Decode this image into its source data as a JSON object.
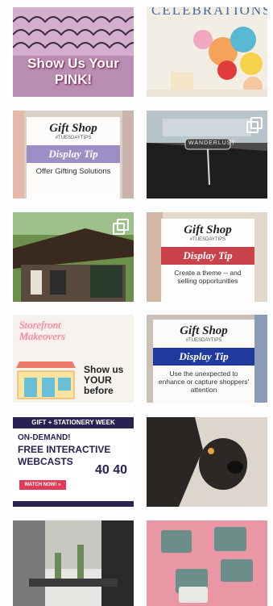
{
  "tiles": [
    {
      "id": "pink",
      "text": "Show Us Your PINK!"
    },
    {
      "id": "celebrations",
      "text": "CELEBRATIONS"
    },
    {
      "id": "tip1",
      "heading": "Gift Shop",
      "tag": "#TUESDAYTIPS",
      "band": "Display Tip",
      "sub": "Offer Gifting Solutions",
      "band_color": "#9b8fc6"
    },
    {
      "id": "wanderlust",
      "text": "WANDERLUST"
    },
    {
      "id": "storefront",
      "text": ""
    },
    {
      "id": "tip2",
      "heading": "Gift Shop",
      "tag": "#TUESDAYTIPS",
      "band": "Display Tip",
      "sub": "Create a theme -- and selling opportunities",
      "band_color": "#c9424a"
    },
    {
      "id": "makeovers",
      "neon": "Storefront Makeovers",
      "text": "Show us YOUR before"
    },
    {
      "id": "tip3",
      "heading": "Gift Shop",
      "tag": "#TUESDAYTIPS",
      "band": "Display Tip",
      "sub": "Use the unexpected to enhance or capture shoppers' attention",
      "band_color": "#1f3a9c"
    },
    {
      "id": "webcast",
      "header": "GIFT + STATIONERY WEEK",
      "line1": "ON-DEMAND!",
      "line2": "FREE INTERACTIVE",
      "line3": "WEBCASTS",
      "btn": "WATCH NOW! »",
      "logo": "40 40"
    },
    {
      "id": "dog",
      "text": ""
    },
    {
      "id": "display",
      "text": ""
    },
    {
      "id": "pouches",
      "text": ""
    }
  ],
  "colors": {
    "pink_bg": "#c99bbd",
    "webcast_navy": "#2a2152",
    "pink_card": "#e996a5"
  }
}
